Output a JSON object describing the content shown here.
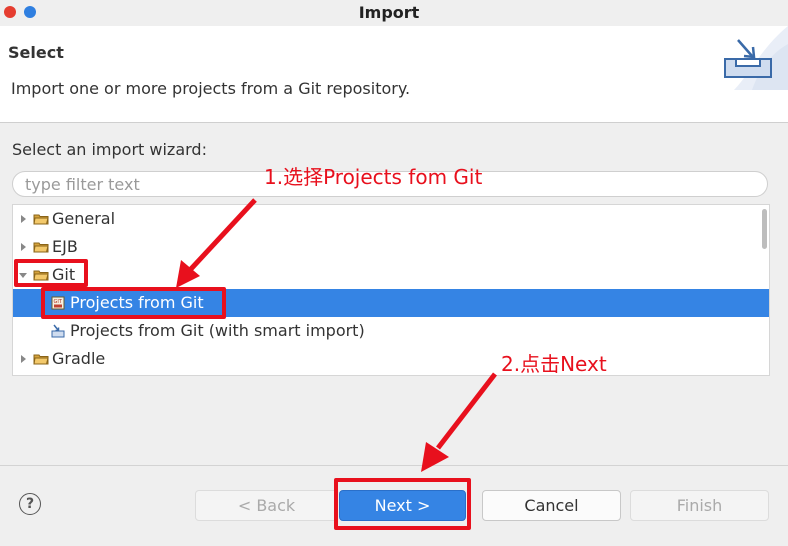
{
  "window": {
    "title": "Import"
  },
  "header": {
    "title": "Select",
    "description": "Import one or more projects from a Git repository."
  },
  "wizard": {
    "label": "Select an import wizard:",
    "filter_placeholder": "type filter text",
    "tree": [
      {
        "label": "General",
        "expanded": false,
        "icon": "folder-icon"
      },
      {
        "label": "EJB",
        "expanded": false,
        "icon": "folder-icon"
      },
      {
        "label": "Git",
        "expanded": true,
        "icon": "folder-open-icon"
      },
      {
        "label": "Projects from Git",
        "selected": true,
        "icon": "git-repo-icon"
      },
      {
        "label": "Projects from Git (with smart import)",
        "selected": false,
        "icon": "smart-import-icon"
      },
      {
        "label": "Gradle",
        "expanded": false,
        "icon": "folder-icon"
      }
    ]
  },
  "annotations": {
    "step1": "1.选择Projects fom Git",
    "step2": "2.点击Next",
    "color": "#e8101d"
  },
  "buttons": {
    "help": "?",
    "back": "< Back",
    "next": "Next >",
    "cancel": "Cancel",
    "finish": "Finish"
  },
  "colors": {
    "selection": "#3584e4",
    "primary_button": "#3584e4"
  }
}
